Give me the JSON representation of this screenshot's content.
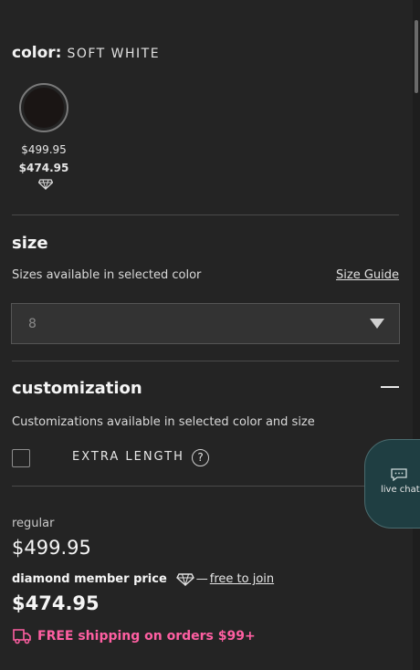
{
  "color": {
    "label": "color:",
    "value": "SOFT WHITE"
  },
  "swatch": {
    "regular_price": "$499.95",
    "member_price": "$474.95",
    "icon": "diamond-icon"
  },
  "size": {
    "title": "size",
    "availability_text": "Sizes available in selected color",
    "guide_link": "Size Guide",
    "selected_value": "8"
  },
  "customization": {
    "title": "customization",
    "availability_text": "Customizations available in selected color and size",
    "extra_length_label": "EXTRA LENGTH",
    "help_glyph": "?"
  },
  "pricing": {
    "regular_label": "regular",
    "regular_price": "$499.95",
    "member_label": "diamond member price",
    "dash": "—",
    "join_link": "free to join",
    "member_price": "$474.95"
  },
  "shipping": {
    "text": "FREE shipping on orders $99+",
    "accent": "#ff5fa2"
  },
  "live_chat": {
    "label": "live chat"
  }
}
